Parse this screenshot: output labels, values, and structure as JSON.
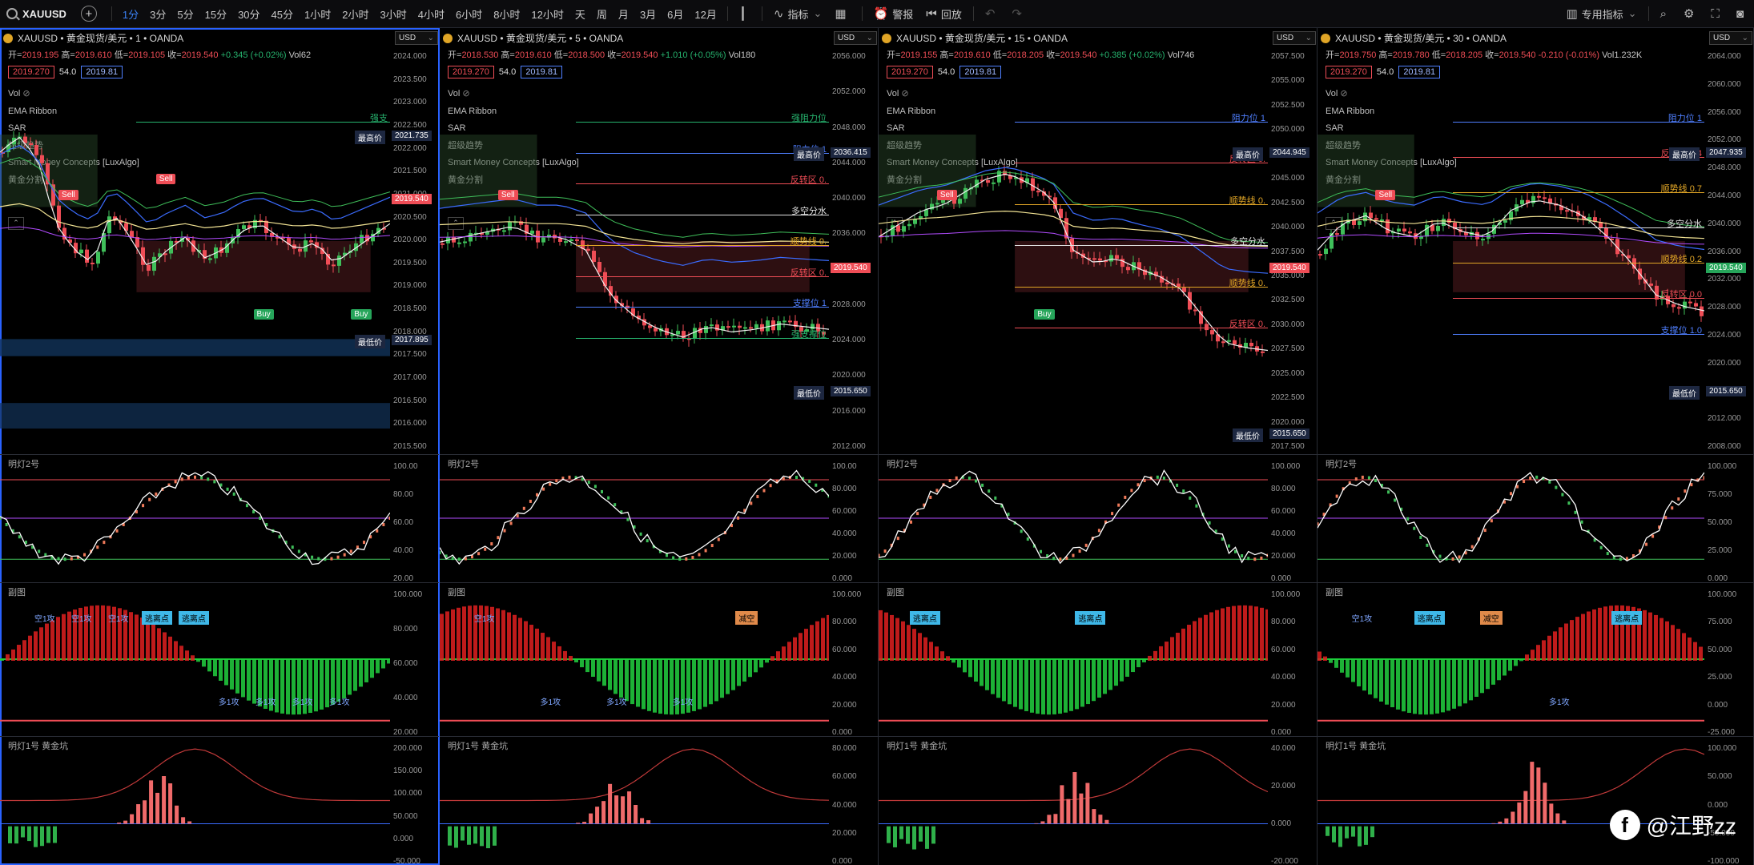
{
  "toolbar": {
    "symbol": "XAUUSD",
    "intervals": [
      "1分",
      "3分",
      "5分",
      "15分",
      "30分",
      "45分",
      "1小时",
      "2小时",
      "3小时",
      "4小时",
      "6小时",
      "8小时",
      "12小时",
      "天",
      "周",
      "月",
      "3月",
      "6月",
      "12月"
    ],
    "active_interval": "1分",
    "indicators_label": "指标",
    "alerts_label": "警报",
    "replay_label": "回放",
    "special_indicator_label": "专用指标"
  },
  "common": {
    "currency": "USD",
    "vol_label": "Vol",
    "indicator_names": [
      "EMA Ribbon",
      "SAR",
      "超级趋势",
      "Smart Money Concepts [LuxAlgo]",
      "黄金分割"
    ],
    "sub1_title": "明灯2号",
    "sub2_title": "副图",
    "sub3_title": "明灯1号 黄金坑",
    "spread": "54.0"
  },
  "panels": [
    {
      "title": "XAUUSD • 黄金现货/美元 • 1 • OANDA",
      "open": "2019.195",
      "high": "2019.610",
      "low": "2019.105",
      "close": "2019.540",
      "change": "+0.345 (+0.02%)",
      "vol": "Vol62",
      "bid": "2019.270",
      "ask": "2019.81",
      "price_axis": [
        "2024.000",
        "2023.500",
        "2023.000",
        "2022.500",
        "2022.000",
        "2021.500",
        "2021.000",
        "2020.500",
        "2020.000",
        "2019.500",
        "2019.000",
        "2018.500",
        "2018.000",
        "2017.500",
        "2017.000",
        "2016.500",
        "2016.000",
        "2015.500"
      ],
      "high_label": "最高价",
      "high_value": "2021.735",
      "last_value": "2019.540",
      "low_label": "最低价",
      "low_value": "2017.895",
      "levels": [
        {
          "text": "强支",
          "color": "#26b36e"
        }
      ],
      "signals": [
        {
          "text": "Sell",
          "kind": "sell"
        },
        {
          "text": "Sell",
          "kind": "sell"
        },
        {
          "text": "Buy",
          "kind": "buy"
        },
        {
          "text": "Buy",
          "kind": "buy"
        }
      ],
      "sub1_axis": [
        "100.00",
        "80.00",
        "60.00",
        "40.00",
        "20.00"
      ],
      "sub2_axis": [
        "100.000",
        "80.000",
        "60.000",
        "40.000",
        "20.000"
      ],
      "sub3_axis": [
        "200.000",
        "150.000",
        "100.000",
        "50.000",
        "0.000",
        "-50.000"
      ],
      "sub2_tags": [
        "空1攻",
        "空1攻",
        "空1攻",
        "逃离点",
        "逃离点",
        "多1攻",
        "多1攻",
        "多1攻",
        "多1攻"
      ]
    },
    {
      "title": "XAUUSD • 黄金现货/美元 • 5 • OANDA",
      "open": "2018.530",
      "high": "2019.610",
      "low": "2018.500",
      "close": "2019.540",
      "change": "+1.010 (+0.05%)",
      "vol": "Vol180",
      "bid": "2019.270",
      "ask": "2019.81",
      "price_axis": [
        "2056.000",
        "2052.000",
        "2048.000",
        "2044.000",
        "2040.000",
        "2036.000",
        "2032.000",
        "2028.000",
        "2024.000",
        "2020.000",
        "2016.000",
        "2012.000"
      ],
      "high_label": "最高价",
      "high_value": "2036.415",
      "last_value": "2019.540",
      "low_label": "最低价",
      "low_value": "2015.650",
      "levels": [
        {
          "text": "强阻力位",
          "color": "#26b36e"
        },
        {
          "text": "阻力位 1",
          "color": "#4f7fff"
        },
        {
          "text": "反转区 0.",
          "color": "#ef4d56"
        },
        {
          "text": "多空分水",
          "color": "#e0e0e0"
        },
        {
          "text": "顺势线 0.",
          "color": "#e0a526"
        },
        {
          "text": "反转区 0.",
          "color": "#ef4d56"
        },
        {
          "text": "支撑位 1",
          "color": "#4f7fff"
        },
        {
          "text": "强支撑位",
          "color": "#26b36e"
        }
      ],
      "signals": [
        {
          "text": "Sell",
          "kind": "sell"
        }
      ],
      "sub1_axis": [
        "100.00",
        "80.000",
        "60.000",
        "40.000",
        "20.000",
        "0.000"
      ],
      "sub2_axis": [
        "100.000",
        "80.000",
        "60.000",
        "40.000",
        "20.000",
        "0.000"
      ],
      "sub3_axis": [
        "80.000",
        "60.000",
        "40.000",
        "20.000",
        "0.000"
      ],
      "sub2_tags": [
        "空1攻",
        "多1攻",
        "多1攻",
        "多1攻",
        "减空"
      ]
    },
    {
      "title": "XAUUSD • 黄金现货/美元 • 15 • OANDA",
      "open": "2019.155",
      "high": "2019.610",
      "low": "2018.205",
      "close": "2019.540",
      "change": "+0.385 (+0.02%)",
      "vol": "Vol746",
      "bid": "2019.270",
      "ask": "2019.81",
      "price_axis": [
        "2057.500",
        "2055.000",
        "2052.500",
        "2050.000",
        "2047.500",
        "2045.000",
        "2042.500",
        "2040.000",
        "2037.500",
        "2035.000",
        "2032.500",
        "2030.000",
        "2027.500",
        "2025.000",
        "2022.500",
        "2020.000",
        "2017.500"
      ],
      "high_label": "最高价",
      "high_value": "2044.945",
      "last_value": "2019.540",
      "low_label": "最低价",
      "low_value": "2015.650",
      "levels": [
        {
          "text": "阻力位 1",
          "color": "#4f7fff"
        },
        {
          "text": "反转区 0.",
          "color": "#ef4d56"
        },
        {
          "text": "顺势线 0.",
          "color": "#e0a526"
        },
        {
          "text": "多空分水",
          "color": "#e0e0e0"
        },
        {
          "text": "顺势线 0.",
          "color": "#e0a526"
        },
        {
          "text": "反转区 0.",
          "color": "#ef4d56"
        }
      ],
      "signals": [
        {
          "text": "Sell",
          "kind": "sell"
        },
        {
          "text": "Buy",
          "kind": "buy"
        }
      ],
      "sub1_axis": [
        "100.000",
        "80.000",
        "60.000",
        "40.000",
        "20.000",
        "0.000"
      ],
      "sub2_axis": [
        "100.000",
        "80.000",
        "60.000",
        "40.000",
        "20.000",
        "0.000"
      ],
      "sub3_axis": [
        "40.000",
        "20.000",
        "0.000",
        "-20.000"
      ],
      "sub2_tags": [
        "逃离点",
        "逃离点"
      ]
    },
    {
      "title": "XAUUSD • 黄金现货/美元 • 30 • OANDA",
      "open": "2019.750",
      "high": "2019.780",
      "low": "2018.205",
      "close": "2019.540",
      "change": "-0.210 (-0.01%)",
      "vol": "Vol1.232K",
      "bid": "2019.270",
      "ask": "2019.81",
      "price_axis": [
        "2064.000",
        "2060.000",
        "2056.000",
        "2052.000",
        "2048.000",
        "2044.000",
        "2040.000",
        "2036.000",
        "2032.000",
        "2028.000",
        "2024.000",
        "2020.000",
        "2016.000",
        "2012.000",
        "2008.000"
      ],
      "high_label": "最高价",
      "high_value": "2047.935",
      "last_value": "2019.540",
      "low_label": "最低价",
      "low_value": "2015.650",
      "levels": [
        {
          "text": "阻力位 1",
          "color": "#4f7fff"
        },
        {
          "text": "反转区 0.4",
          "color": "#ef4d56"
        },
        {
          "text": "顺势线 0.7",
          "color": "#e0a526"
        },
        {
          "text": "多空分水",
          "color": "#e0e0e0"
        },
        {
          "text": "顺势线 0.2",
          "color": "#e0a526"
        },
        {
          "text": "反转区 0.0",
          "color": "#ef4d56"
        },
        {
          "text": "支撑位 1.0",
          "color": "#4f7fff"
        }
      ],
      "signals": [
        {
          "text": "Sell",
          "kind": "sell"
        }
      ],
      "sub1_axis": [
        "100.000",
        "75.000",
        "50.000",
        "25.000",
        "0.000"
      ],
      "sub2_axis": [
        "100.000",
        "75.000",
        "50.000",
        "25.000",
        "0.000",
        "-25.000"
      ],
      "sub3_axis": [
        "100.000",
        "50.000",
        "0.000",
        "-50.000",
        "-100.000"
      ],
      "sub2_tags": [
        "空1攻",
        "逃离点",
        "减空",
        "多1攻",
        "逃离点"
      ]
    }
  ],
  "watermark": {
    "handle": "@江野zz",
    "logo": "f"
  }
}
